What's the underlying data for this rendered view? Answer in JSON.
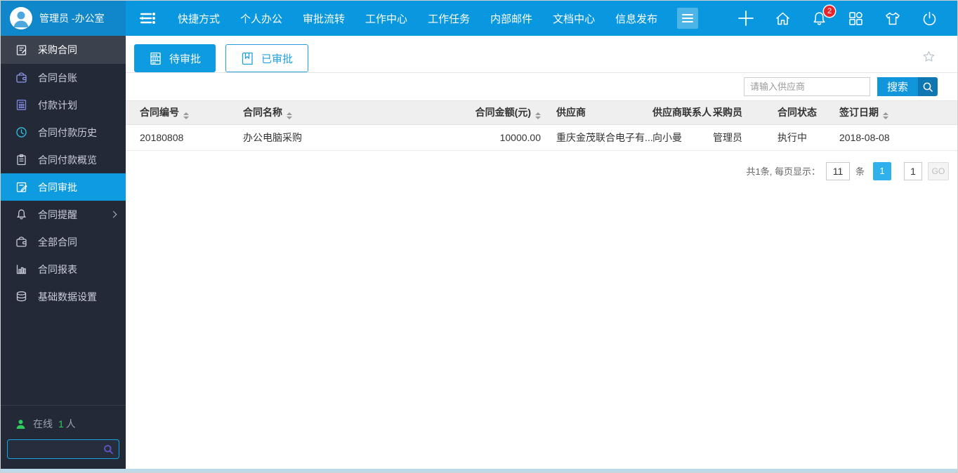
{
  "header": {
    "user": {
      "name": "管理员 -办公室"
    },
    "nav_items": [
      {
        "label": "快捷方式"
      },
      {
        "label": "个人办公"
      },
      {
        "label": "审批流转"
      },
      {
        "label": "工作中心"
      },
      {
        "label": "工作任务"
      },
      {
        "label": "内部邮件"
      },
      {
        "label": "文档中心"
      },
      {
        "label": "信息发布"
      }
    ],
    "notification_count": "2"
  },
  "sidebar": {
    "items": [
      {
        "label": "采购合同",
        "icon": "document-edit-icon",
        "type": "group-header"
      },
      {
        "label": "合同台账",
        "icon": "wallet-icon"
      },
      {
        "label": "付款计划",
        "icon": "calculator-icon"
      },
      {
        "label": "合同付款历史",
        "icon": "clock-icon"
      },
      {
        "label": "合同付款概览",
        "icon": "clipboard-icon"
      },
      {
        "label": "合同审批",
        "icon": "approve-document-icon",
        "active": true
      },
      {
        "label": "合同提醒",
        "icon": "bell-icon",
        "has_submenu": true
      },
      {
        "label": "全部合同",
        "icon": "wallet-icon"
      },
      {
        "label": "合同报表",
        "icon": "bar-chart-icon"
      },
      {
        "label": "基础数据设置",
        "icon": "database-icon"
      }
    ],
    "online": {
      "prefix": "在线",
      "count": "1",
      "suffix": "人"
    }
  },
  "tabs": [
    {
      "label": "待审批",
      "active": true,
      "icon": "bookshelf-icon"
    },
    {
      "label": "已审批",
      "active": false,
      "icon": "book-bookmark-icon"
    }
  ],
  "filter": {
    "supplier_placeholder": "请输入供应商",
    "search_label": "搜索"
  },
  "table": {
    "columns": [
      {
        "label": "合同编号",
        "sortable": true
      },
      {
        "label": "合同名称",
        "sortable": true
      },
      {
        "label": "合同金额(元)",
        "sortable": true,
        "align": "right"
      },
      {
        "label": "供应商",
        "sortable": false
      },
      {
        "label": "供应商联系人",
        "sortable": false
      },
      {
        "label": "采购员",
        "sortable": false
      },
      {
        "label": "合同状态",
        "sortable": false
      },
      {
        "label": "签订日期",
        "sortable": true
      }
    ],
    "rows": [
      [
        "20180808",
        "办公电脑采购",
        "10000.00",
        "重庆金茂联合电子有...",
        "向小曼",
        "管理员",
        "执行中",
        "2018-08-08"
      ]
    ]
  },
  "pagination": {
    "summary": "共1条, 每页显示：",
    "page_size": "11",
    "unit": "条",
    "current_page": "1",
    "goto_value": "1",
    "go_label": "GO"
  },
  "colors": {
    "topbar_blue": "#0998DF",
    "user_block_blue": "#1187CB",
    "sidebar_dark": "#232936",
    "sidebar_active_blue": "#0F9BDF",
    "accent_blue": "#1195DB",
    "search_mag_blue": "#0E76B0",
    "pagination_active_blue": "#2FB2EC",
    "badge_red": "#E7252B",
    "online_green": "#2ECC5E",
    "table_header_gray": "#EFEFEF"
  }
}
